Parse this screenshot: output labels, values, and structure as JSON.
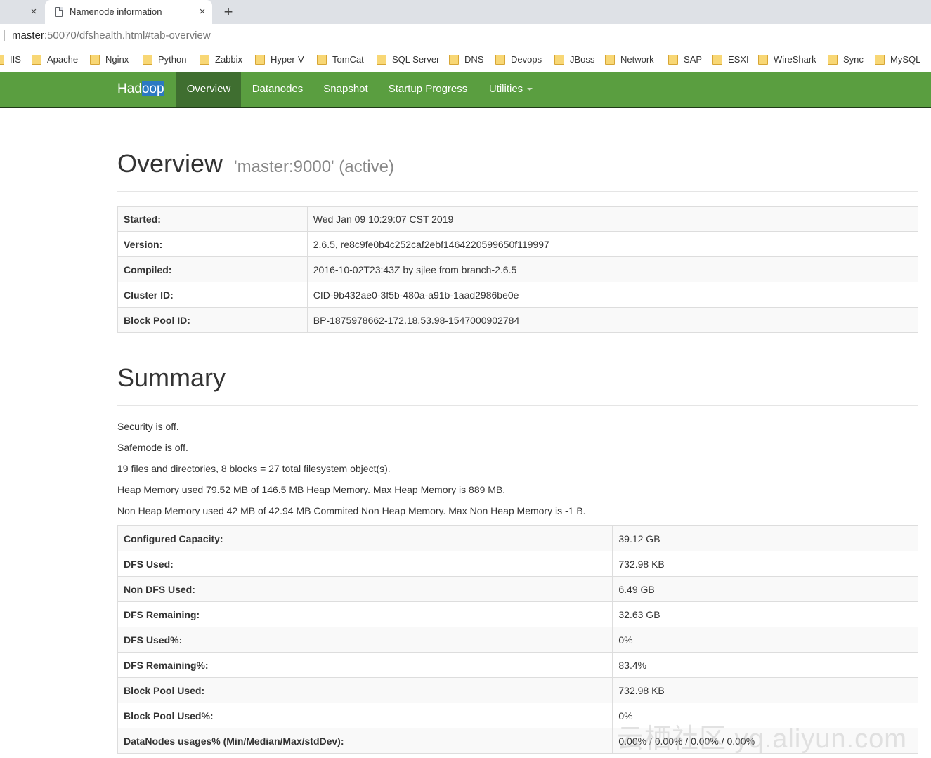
{
  "browser": {
    "prev_tab_close": "×",
    "tab": {
      "title": "Namenode information",
      "close": "×"
    },
    "new_tab": "+",
    "url": {
      "host": "master",
      "rest": ":50070/dfshealth.html#tab-overview"
    },
    "bookmarks": [
      "IIS",
      "Apache",
      "Nginx",
      "Python",
      "Zabbix",
      "Hyper-V",
      "TomCat",
      "SQL Server",
      "DNS",
      "Devops",
      "JBoss",
      "Network",
      "SAP",
      "ESXI",
      "WireShark",
      "Sync",
      "MySQL"
    ]
  },
  "navbar": {
    "brand_a": "Had",
    "brand_b": "oop",
    "items": [
      "Overview",
      "Datanodes",
      "Snapshot",
      "Startup Progress",
      "Utilities"
    ],
    "active": "Overview",
    "color": "#5a9e40"
  },
  "overview": {
    "title": "Overview",
    "subtitle": "'master:9000' (active)",
    "rows": [
      {
        "k": "Started:",
        "v": "Wed Jan 09 10:29:07 CST 2019"
      },
      {
        "k": "Version:",
        "v": "2.6.5, re8c9fe0b4c252caf2ebf1464220599650f119997"
      },
      {
        "k": "Compiled:",
        "v": "2016-10-02T23:43Z by sjlee from branch-2.6.5"
      },
      {
        "k": "Cluster ID:",
        "v": "CID-9b432ae0-3f5b-480a-a91b-1aad2986be0e"
      },
      {
        "k": "Block Pool ID:",
        "v": "BP-1875978662-172.18.53.98-1547000902784"
      }
    ]
  },
  "summary": {
    "title": "Summary",
    "lines": [
      "Security is off.",
      "Safemode is off.",
      "19 files and directories, 8 blocks = 27 total filesystem object(s).",
      "Heap Memory used 79.52 MB of 146.5 MB Heap Memory. Max Heap Memory is 889 MB.",
      "Non Heap Memory used 42 MB of 42.94 MB Commited Non Heap Memory. Max Non Heap Memory is -1 B."
    ],
    "rows": [
      {
        "k": "Configured Capacity:",
        "v": "39.12 GB"
      },
      {
        "k": "DFS Used:",
        "v": "732.98 KB"
      },
      {
        "k": "Non DFS Used:",
        "v": "6.49 GB"
      },
      {
        "k": "DFS Remaining:",
        "v": "32.63 GB"
      },
      {
        "k": "DFS Used%:",
        "v": "0%"
      },
      {
        "k": "DFS Remaining%:",
        "v": "83.4%"
      },
      {
        "k": "Block Pool Used:",
        "v": "732.98 KB"
      },
      {
        "k": "Block Pool Used%:",
        "v": "0%"
      },
      {
        "k": "DataNodes usages% (Min/Median/Max/stdDev):",
        "v": "0.00% / 0.00% / 0.00% / 0.00%"
      }
    ]
  },
  "watermark": "云栖社区 yq.aliyun.com"
}
